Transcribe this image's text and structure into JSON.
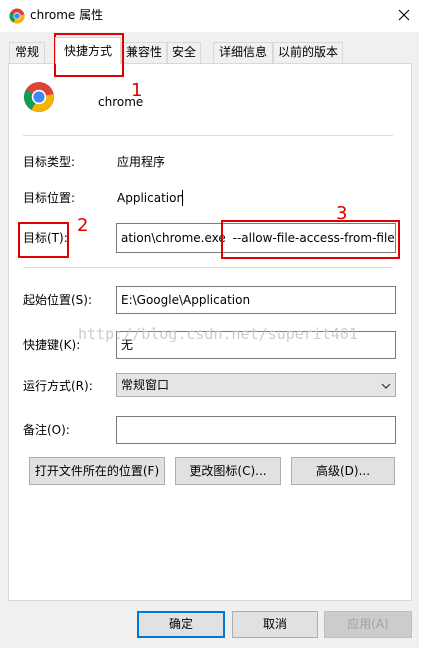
{
  "window": {
    "title": "chrome 属性"
  },
  "tabs": [
    {
      "label": "常规"
    },
    {
      "label": "快捷方式"
    },
    {
      "label": "兼容性"
    },
    {
      "label": "安全"
    },
    {
      "label": "详细信息"
    },
    {
      "label": "以前的版本"
    }
  ],
  "shortcut": {
    "name": "chrome",
    "target_type_label": "目标类型:",
    "target_type_value": "应用程序",
    "target_location_label": "目标位置:",
    "target_location_value": "Application",
    "target_label": "目标(T):",
    "target_value_part1": "ation\\chrome.exe",
    "target_value_part2": "--allow-file-access-from-files",
    "start_in_label": "起始位置(S):",
    "start_in_value": "E:\\Google\\Application",
    "hotkey_label": "快捷键(K):",
    "hotkey_value": "无",
    "run_label": "运行方式(R):",
    "run_value": "常规窗口",
    "comment_label": "备注(O):",
    "comment_value": ""
  },
  "actions": {
    "open_location": "打开文件所在的位置(F)",
    "change_icon": "更改图标(C)...",
    "advanced": "高级(D)..."
  },
  "dialog_buttons": {
    "ok": "确定",
    "cancel": "取消",
    "apply": "应用(A)"
  },
  "annotations": {
    "n1": "1",
    "n2": "2",
    "n3": "3"
  },
  "watermark": "http://blog.csdn.net/superit401",
  "colors": {
    "annotation": "#e00000",
    "focus": "#0078d7"
  }
}
